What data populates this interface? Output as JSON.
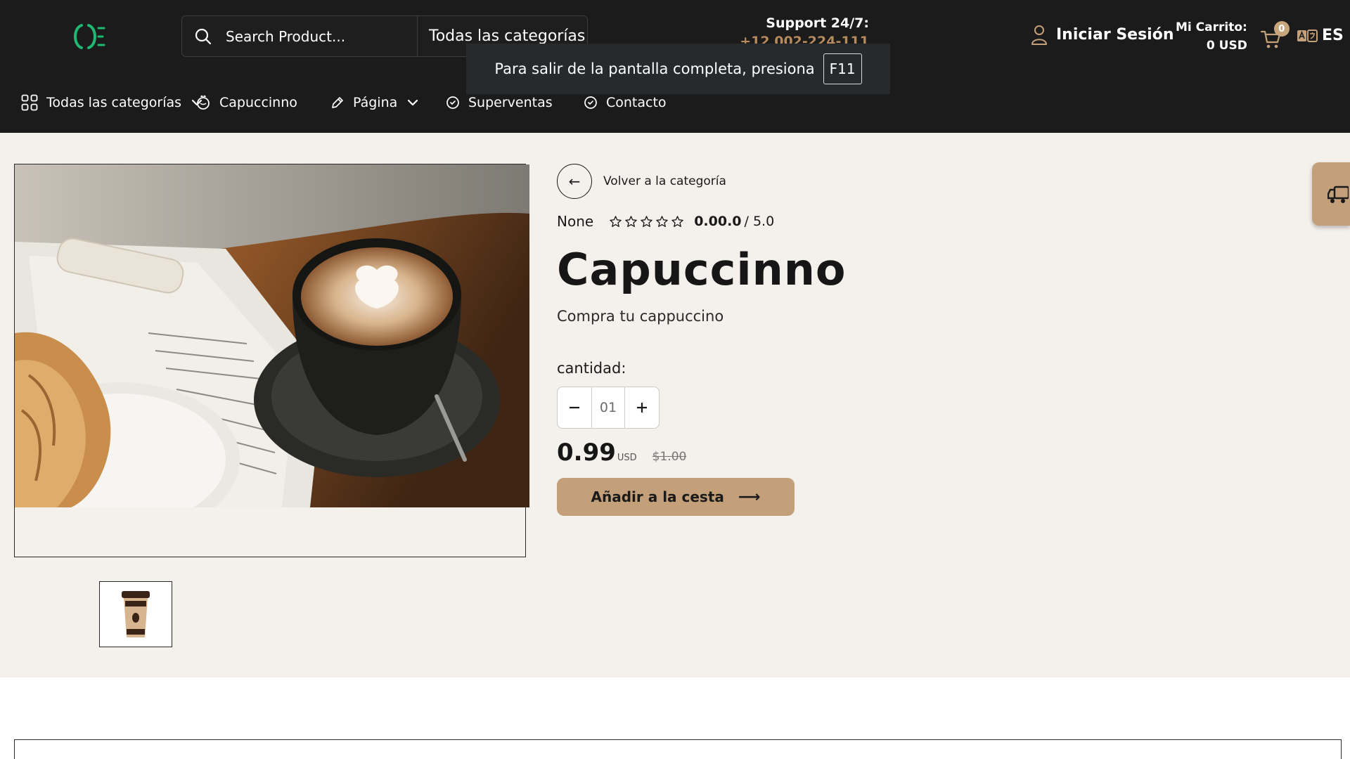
{
  "header": {
    "search": {
      "placeholder": "Search Product...",
      "category": "Todas las categorías"
    },
    "support": {
      "label": "Support 24/7:",
      "phone": "+12 002-224-111"
    },
    "fullscreen_notice": {
      "text": "Para salir de la pantalla completa, presiona",
      "key": "F11"
    },
    "login_label": "Iniciar Sesión",
    "cart": {
      "label": "Mi Carrito:",
      "total": "0 USD",
      "count": "0"
    },
    "language": "ES"
  },
  "nav": {
    "items": [
      {
        "label": "Todas las categorías",
        "icon": "grid-icon",
        "has_dropdown": true
      },
      {
        "label": "Capuccinno",
        "icon": "coffee-icon",
        "has_dropdown": false
      },
      {
        "label": "Página",
        "icon": "pencil-icon",
        "has_dropdown": true
      },
      {
        "label": "Superventas",
        "icon": "badge-icon",
        "has_dropdown": false
      },
      {
        "label": "Contacto",
        "icon": "badge-icon",
        "has_dropdown": false
      }
    ]
  },
  "product": {
    "back_label": "Volver a la categoría",
    "brand": "None",
    "stars": 0,
    "rating": "0.00.0",
    "rating_max": "/ 5.0",
    "title": "Capuccinno",
    "description": "Compra tu cappuccino",
    "quantity_label": "cantidad:",
    "quantity": "01",
    "price": "0.99",
    "currency": "USD",
    "old_price": "$1.00",
    "add_to_cart_label": "Añadir a la cesta"
  },
  "colors": {
    "header_bg": "#1b1b1b",
    "main_bg": "#f4f0ec",
    "accent": "#c3a07a",
    "logo_green": "#1fb872"
  }
}
